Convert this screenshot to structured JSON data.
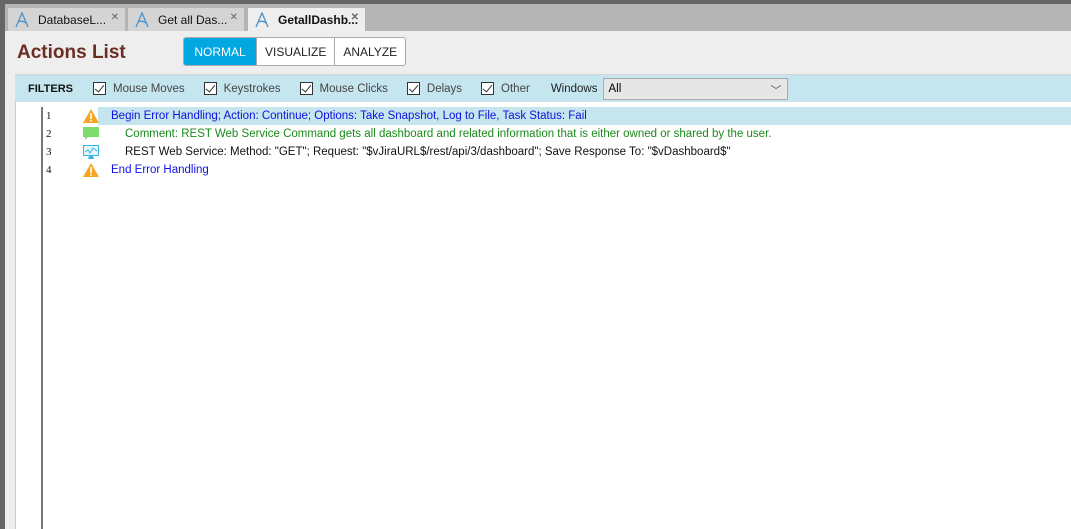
{
  "tabs": [
    {
      "label": "DatabaseL...",
      "active": false
    },
    {
      "label": "Get all Das...",
      "active": false
    },
    {
      "label": "GetallDashb...",
      "active": true
    }
  ],
  "header": {
    "title": "Actions List",
    "modes": [
      "NORMAL",
      "VISUALIZE",
      "ANALYZE"
    ],
    "active_mode": "NORMAL"
  },
  "filters": {
    "label": "FILTERS",
    "items": [
      {
        "label": "Mouse Moves",
        "checked": true
      },
      {
        "label": "Keystrokes",
        "checked": true
      },
      {
        "label": "Mouse Clicks",
        "checked": true
      },
      {
        "label": "Delays",
        "checked": true
      },
      {
        "label": "Other",
        "checked": true
      }
    ],
    "windows_label": "Windows",
    "windows_value": "All"
  },
  "actions": [
    {
      "num": "1",
      "icon": "warning-icon",
      "text": "Begin Error Handling; Action: Continue; Options: Take Snapshot, Log to File,  Task Status: Fail",
      "color": "#1010e0",
      "indent": false,
      "selected": true
    },
    {
      "num": "2",
      "icon": "comment-icon",
      "text": "Comment: REST Web Service Command gets all dashboard and related information that is either owned or shared by the user.",
      "color": "#1a8a1a",
      "indent": true,
      "selected": false
    },
    {
      "num": "3",
      "icon": "web-service-icon",
      "text": "REST Web Service: Method: \"GET\"; Request: \"$vJiraURL$/rest/api/3/dashboard\"; Save Response To: \"$vDashboard$\"",
      "color": "#111111",
      "indent": true,
      "selected": false
    },
    {
      "num": "4",
      "icon": "warning-icon",
      "text": "End Error Handling",
      "color": "#1010e0",
      "indent": false,
      "selected": false
    }
  ]
}
